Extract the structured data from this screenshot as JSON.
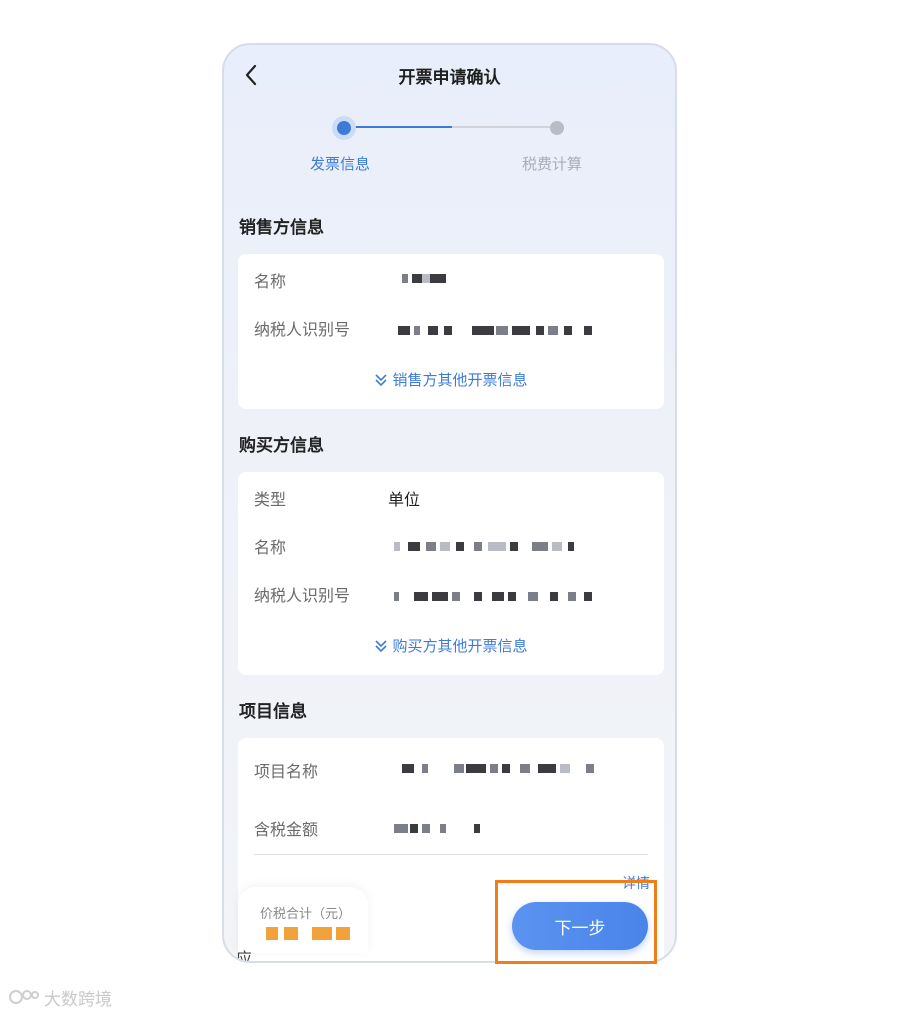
{
  "header": {
    "title": "开票申请确认"
  },
  "stepper": {
    "steps": [
      {
        "label": "发票信息"
      },
      {
        "label": "税费计算"
      }
    ],
    "accent": "#3d7bd8",
    "inactive": "#b8bcc4"
  },
  "seller": {
    "section_title": "销售方信息",
    "fields": [
      {
        "label": "名称"
      },
      {
        "label": "纳税人识别号"
      }
    ],
    "expand_label": "销售方其他开票信息"
  },
  "buyer": {
    "section_title": "购买方信息",
    "fields": [
      {
        "label": "类型",
        "value": "单位"
      },
      {
        "label": "名称"
      },
      {
        "label": "纳税人识别号"
      }
    ],
    "expand_label": "购买方其他开票信息"
  },
  "project": {
    "section_title": "项目信息",
    "fields": [
      {
        "label": "项目名称"
      },
      {
        "label": "含税金额"
      }
    ],
    "detail_label": "详情"
  },
  "bottom": {
    "total_label": "价税合计（元）",
    "partial_char": "应",
    "next_label": "下一步"
  },
  "watermark": {
    "text": "大数跨境"
  },
  "colors": {
    "highlight": "#ef7d1a",
    "button": "#4a84ea"
  }
}
